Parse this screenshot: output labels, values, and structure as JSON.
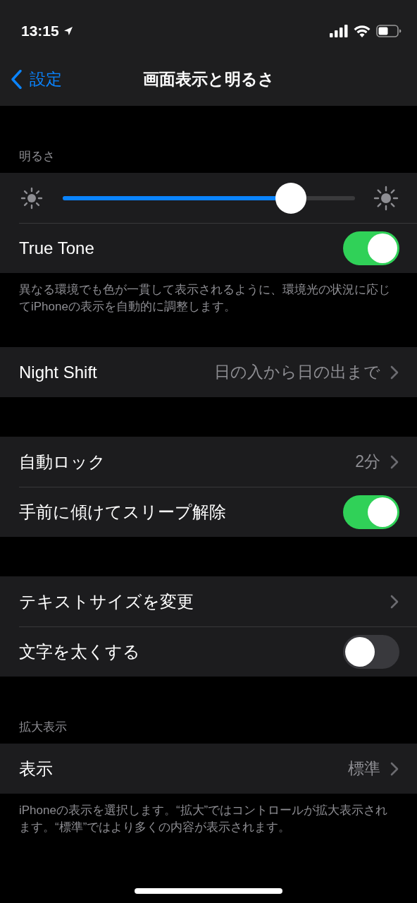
{
  "status_bar": {
    "time": "13:15"
  },
  "nav": {
    "back": "設定",
    "title": "画面表示と明るさ"
  },
  "sections": [
    {
      "header": "明るさ",
      "rows": [
        {
          "kind": "slider",
          "level": 0.78
        },
        {
          "kind": "toggle",
          "label": "True Tone",
          "on": true
        }
      ],
      "footer": "異なる環境でも色が一貫して表示されるように、環境光の状況に応じてiPhoneの表示を自動的に調整します。"
    },
    {
      "rows": [
        {
          "kind": "link",
          "label": "Night Shift",
          "value": "日の入から日の出まで"
        }
      ]
    },
    {
      "rows": [
        {
          "kind": "link",
          "label": "自動ロック",
          "value": "2分"
        },
        {
          "kind": "toggle",
          "label": "手前に傾けてスリープ解除",
          "on": true
        }
      ]
    },
    {
      "rows": [
        {
          "kind": "link",
          "label": "テキストサイズを変更"
        },
        {
          "kind": "toggle",
          "label": "文字を太くする",
          "on": false
        }
      ]
    },
    {
      "header": "拡大表示",
      "rows": [
        {
          "kind": "link",
          "label": "表示",
          "value": "標準"
        }
      ],
      "footer": "iPhoneの表示を選択します。“拡大”ではコントロールが拡大表示されます。“標準”ではより多くの内容が表示されます。"
    }
  ]
}
